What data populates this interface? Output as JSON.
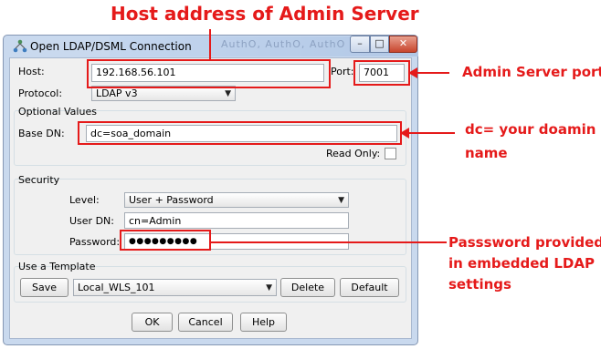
{
  "window": {
    "title": "Open LDAP/DSML Connection",
    "blurred_tabs": "AuthO,  AuthO,  AuthO"
  },
  "connection": {
    "host_label": "Host:",
    "host_value": "192.168.56.101",
    "port_label": "Port:",
    "port_value": "7001",
    "protocol_label": "Protocol:",
    "protocol_value": "LDAP v3"
  },
  "optional_values": {
    "title": "Optional Values",
    "base_dn_label": "Base DN:",
    "base_dn_value": "dc=soa_domain",
    "read_only_label": "Read Only:",
    "read_only_checked": false
  },
  "security": {
    "title": "Security",
    "level_label": "Level:",
    "level_value": "User + Password",
    "user_dn_label": "User DN:",
    "user_dn_value": "cn=Admin",
    "password_label": "Password:",
    "password_mask": "●●●●●●●●●"
  },
  "template": {
    "title": "Use a Template",
    "save_label": "Save",
    "template_value": "Local_WLS_101",
    "delete_label": "Delete",
    "default_label": "Default"
  },
  "footer": {
    "ok_label": "OK",
    "cancel_label": "Cancel",
    "help_label": "Help"
  },
  "annotations": {
    "host_note": "Host address of Admin Server",
    "port_note": "Admin Server port",
    "dc_note_line1": "dc= your doamin",
    "dc_note_line2": "name",
    "password_note_line1": "Passsword provided",
    "password_note_line2": "in embedded LDAP",
    "password_note_line3": "settings",
    "color": "#e51a1a"
  }
}
